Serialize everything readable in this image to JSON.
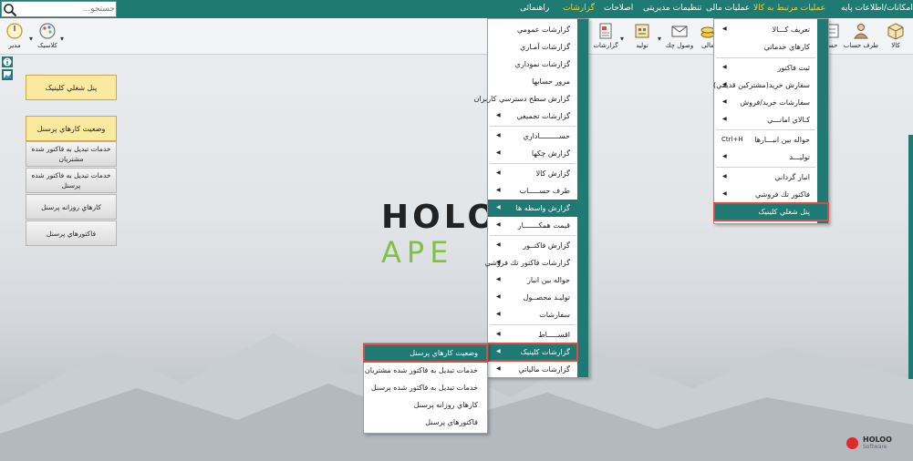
{
  "search": {
    "placeholder": "جستجو..."
  },
  "menubar": {
    "items": [
      {
        "id": "base",
        "label": "امکانات/اطلاعات پایه"
      },
      {
        "id": "goods",
        "label": "عملیات مرتبط به کالا"
      },
      {
        "id": "finance",
        "label": "عملیات مالی"
      },
      {
        "id": "settings",
        "label": "تنظیمات مدیریتی"
      },
      {
        "id": "corrections",
        "label": "اصلاحات"
      },
      {
        "id": "reports",
        "label": "گزارشات"
      },
      {
        "id": "help",
        "label": "راهنمائی"
      }
    ]
  },
  "toolbar": {
    "left": [
      {
        "label": "مدیر",
        "icon": "gauge-icon"
      },
      {
        "label": "کلاسیک",
        "icon": "palette-icon"
      }
    ],
    "right": [
      {
        "label": "کالا",
        "icon": "box-icon"
      },
      {
        "label": "طرف حساب",
        "icon": "person-icon"
      },
      {
        "label": "حسا",
        "icon": "ledger-icon"
      },
      {
        "label": "مالی",
        "icon": "coins-icon"
      },
      {
        "label": "وصول چك",
        "icon": "cheque-icon"
      },
      {
        "label": "تولید",
        "icon": "factory-icon"
      },
      {
        "label": "گزارشات",
        "icon": "report-icon"
      }
    ]
  },
  "brand": {
    "line1": "HOLO",
    "line2": "APE"
  },
  "small_logo": {
    "name": "HOLOO",
    "sub": "Software",
    "fa": "هلو"
  },
  "side_panel": {
    "title_tile": "پنل شغلي كلينيک",
    "status_tile": "وضعيت كارهاي پرسنل",
    "tiles": [
      "خدمات تبديل به فاكتور شده مشتريان",
      "خدمات تبديل به فاكتور شده پرسنل",
      "كارهاي روزانه پرسنل",
      "فاكتورهاي پرسنل"
    ]
  },
  "goods_menu": {
    "items": [
      {
        "label": "تعريف كـــالا",
        "arrow": true
      },
      {
        "label": "كارهاي خدماتي",
        "arrow": false
      },
      {
        "label": "ثبت فاكتور",
        "arrow": true
      },
      {
        "label": "سفارش خريد(مشتركين قديمي)",
        "arrow": true
      },
      {
        "label": "سفارشات خريد/فروش",
        "arrow": true
      },
      {
        "label": "كـالاي امانـــي",
        "arrow": true
      },
      {
        "label": "حواله بين انبـــارها",
        "shortcut": "Ctrl+H",
        "arrow": false
      },
      {
        "label": "توليـــد",
        "arrow": true
      },
      {
        "label": "انبار گرداني",
        "arrow": true
      },
      {
        "label": "فاكتور تك فروشي",
        "arrow": true
      },
      {
        "label": "پنل شغلي كلينيک",
        "arrow": false
      }
    ]
  },
  "reports_menu": {
    "items": [
      {
        "label": "گزارشات عمومي",
        "arrow": false
      },
      {
        "label": "گزارشات آمـاري",
        "arrow": false
      },
      {
        "label": "گزارشات نموداري",
        "arrow": false
      },
      {
        "label": "مرور حسابها",
        "arrow": false
      },
      {
        "label": "گزارش سطح دسترسي كاربران",
        "arrow": false
      },
      {
        "label": "گزارشات تجميعي",
        "arrow": true
      },
      {
        "label": "حســـــــــاداري",
        "arrow": true
      },
      {
        "label": "گزارش چكها",
        "arrow": true
      },
      {
        "label": "گزارش كالا",
        "arrow": true
      },
      {
        "label": "طرف حســـــاب",
        "arrow": true
      },
      {
        "label": "گزارش واسطه ها",
        "arrow": true
      },
      {
        "label": "قيمت همكـــــــار",
        "arrow": true
      },
      {
        "label": "گزارش فاكتــور",
        "arrow": true
      },
      {
        "label": "گزارشات فاكتور تك فروشي",
        "arrow": true
      },
      {
        "label": "حواله بين انبار",
        "arrow": true
      },
      {
        "label": "توليـد محصــول",
        "arrow": true
      },
      {
        "label": "سفارشات",
        "arrow": true
      },
      {
        "label": "اقســـــاط",
        "arrow": true
      },
      {
        "label": "گزارشات كلينيک",
        "arrow": true
      },
      {
        "label": "گزارشات مالياتي",
        "arrow": true
      }
    ]
  },
  "clinic_submenu": {
    "items": [
      "وضعيت كارهاي پرسنل",
      "خدمات تبديل به فاكتور شده مشتريان",
      "خدمات تبديل به فاكتور شده پرسنل",
      "كارهاي روزانه پرسنل",
      "فاكتورهاي پرسنل"
    ]
  },
  "colors": {
    "teal": "#1e7a72",
    "highlight_box": "#e04a40",
    "active_menu": "#f4d23c"
  }
}
